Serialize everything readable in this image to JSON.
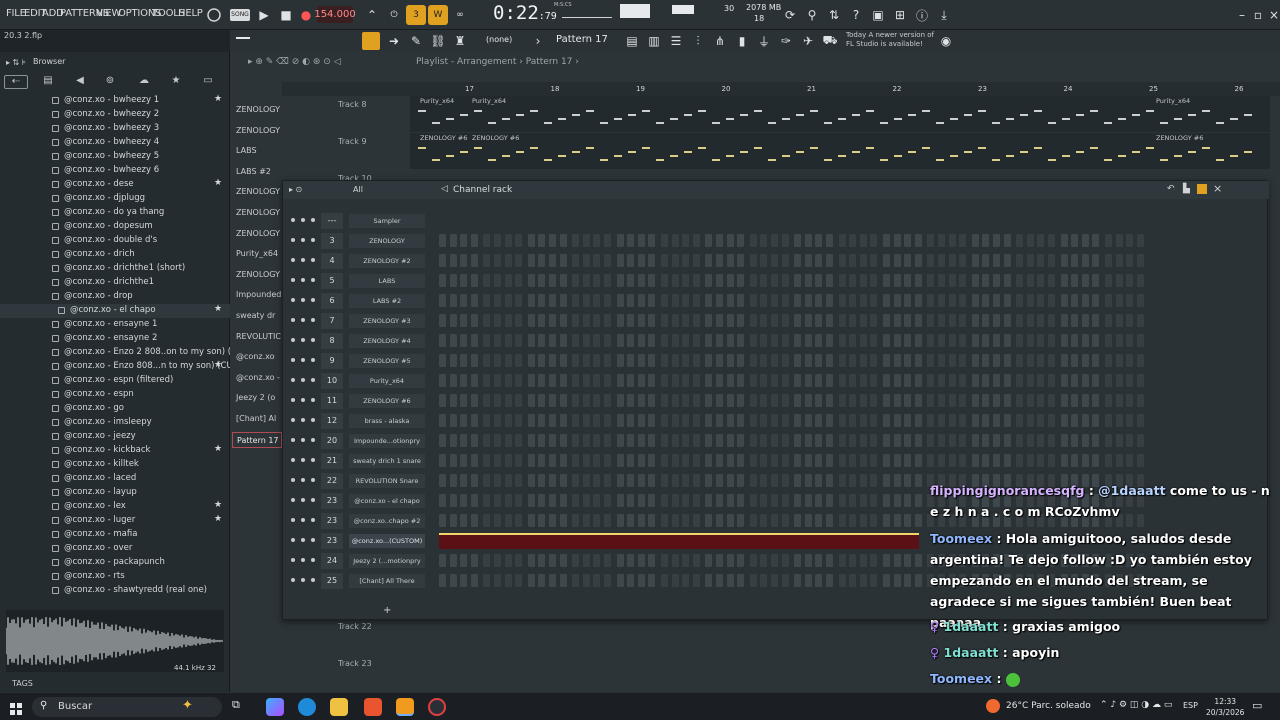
{
  "menu": [
    "FILE",
    "EDIT",
    "ADD",
    "PATTERNS",
    "VIEW",
    "OPTIONS",
    "TOOLS",
    "HELP"
  ],
  "transport": {
    "mode_badge": "SONG",
    "tempo": "154.000",
    "time_main": "0:22",
    "time_frac": ":79",
    "time_unit": "M:S:CS",
    "memory": "2078 MB",
    "cpu_top": "30",
    "cpu_bottom": "18"
  },
  "project": {
    "file": "20.3 2.flp"
  },
  "toolbar": {
    "none_label": "(none)",
    "pattern_label": "Pattern 17",
    "update_hint_line1": "Today  A newer version of",
    "update_hint_line2": "FL Studio is available!"
  },
  "browser": {
    "title": "Browser",
    "items": [
      {
        "label": "@conz.xo - bwheezy 1",
        "star": true
      },
      {
        "label": "@conz.xo - bwheezy 2",
        "star": false
      },
      {
        "label": "@conz.xo - bwheezy 3",
        "star": false
      },
      {
        "label": "@conz.xo - bwheezy 4",
        "star": false
      },
      {
        "label": "@conz.xo - bwheezy 5",
        "star": false
      },
      {
        "label": "@conz.xo - bwheezy 6",
        "star": false
      },
      {
        "label": "@conz.xo - dese",
        "star": true
      },
      {
        "label": "@conz.xo - djplugg",
        "star": false
      },
      {
        "label": "@conz.xo - do ya thang",
        "star": false
      },
      {
        "label": "@conz.xo - dopesum",
        "star": false
      },
      {
        "label": "@conz.xo - double d's",
        "star": false
      },
      {
        "label": "@conz.xo - drich",
        "star": false
      },
      {
        "label": "@conz.xo - drichthe1 (short)",
        "star": false
      },
      {
        "label": "@conz.xo - drichthe1",
        "star": false
      },
      {
        "label": "@conz.xo - drop",
        "star": false
      },
      {
        "label": "@conz.xo - el chapo",
        "star": true,
        "selected": true
      },
      {
        "label": "@conz.xo - ensayne 1",
        "star": false
      },
      {
        "label": "@conz.xo - ensayne 2",
        "star": false
      },
      {
        "label": "@conz.xo - Enzo 2 808..on to my son) (CUSTOM)",
        "star": false
      },
      {
        "label": "@conz.xo - Enzo 808...n to my son) (CUSTOM)",
        "star": true
      },
      {
        "label": "@conz.xo - espn (filtered)",
        "star": false
      },
      {
        "label": "@conz.xo - espn",
        "star": false
      },
      {
        "label": "@conz.xo - go",
        "star": false
      },
      {
        "label": "@conz.xo - imsleepy",
        "star": false
      },
      {
        "label": "@conz.xo - jeezy",
        "star": false
      },
      {
        "label": "@conz.xo - kickback",
        "star": true
      },
      {
        "label": "@conz.xo - killtek",
        "star": false
      },
      {
        "label": "@conz.xo - laced",
        "star": false
      },
      {
        "label": "@conz.xo - layup",
        "star": false
      },
      {
        "label": "@conz.xo - lex",
        "star": true
      },
      {
        "label": "@conz.xo - luger",
        "star": true
      },
      {
        "label": "@conz.xo - mafia",
        "star": false
      },
      {
        "label": "@conz.xo - over",
        "star": false
      },
      {
        "label": "@conz.xo - packapunch",
        "star": false
      },
      {
        "label": "@conz.xo - rts",
        "star": false
      },
      {
        "label": "@conz.xo - shawtyredd (real one)",
        "star": false
      }
    ],
    "sample_info": "44.1 kHz 32",
    "tags_label": "TAGS"
  },
  "playlist": {
    "title": "Playlist - Arrangement",
    "pattern": "Pattern 17",
    "ruler": [
      "17",
      "18",
      "19",
      "20",
      "21",
      "22",
      "23",
      "24",
      "25",
      "26"
    ],
    "patterns": [
      "ZENOLOGY",
      "ZENOLOGY #2",
      "LABS",
      "LABS #2",
      "ZENOLOGY",
      "ZENOLOGY",
      "ZENOLOGY",
      "Purity_x64",
      "ZENOLOGY",
      "Impounded",
      "sweaty dr",
      "REVOLUTIC",
      "@conz.xo",
      "@conz.xo -",
      "Jeezy 2 (o",
      "[Chant] Al",
      "Pattern 17"
    ],
    "tracks": [
      {
        "label": "Track 8",
        "clips": [
          "Purity_x64",
          "Purity_x64",
          "Purity_x64"
        ]
      },
      {
        "label": "Track 9",
        "clips": [
          "ZENOLOGY #6",
          "ZENOLOGY #6",
          "ZENOLOGY #6"
        ]
      },
      {
        "label": "Track 10"
      }
    ],
    "bottom_tracks": [
      "Track 22",
      "Track 23"
    ]
  },
  "channel_rack": {
    "title": "Channel rack",
    "filter": "All",
    "channels": [
      {
        "num": "---",
        "name": "Sampler"
      },
      {
        "num": "3",
        "name": "ZENOLOGY"
      },
      {
        "num": "4",
        "name": "ZENOLOGY #2"
      },
      {
        "num": "5",
        "name": "LABS"
      },
      {
        "num": "6",
        "name": "LABS #2"
      },
      {
        "num": "7",
        "name": "ZENOLOGY #3"
      },
      {
        "num": "8",
        "name": "ZENOLOGY #4"
      },
      {
        "num": "9",
        "name": "ZENOLOGY #5"
      },
      {
        "num": "10",
        "name": "Purity_x64"
      },
      {
        "num": "11",
        "name": "ZENOLOGY #6"
      },
      {
        "num": "12",
        "name": "brass - alaska"
      },
      {
        "num": "20",
        "name": "Impounde...otionpry"
      },
      {
        "num": "21",
        "name": "sweaty drich 1 snare"
      },
      {
        "num": "22",
        "name": "REVOLUTION Snare"
      },
      {
        "num": "23",
        "name": "@conz.xo - el chapo"
      },
      {
        "num": "23",
        "name": "@conz.xo..chapo #2"
      },
      {
        "num": "23",
        "name": "@conz.xo...(CUSTOM)",
        "highlight": true
      },
      {
        "num": "24",
        "name": "Jeezy 2 (...motionpry"
      },
      {
        "num": "25",
        "name": "[Chant] All There"
      }
    ]
  },
  "chat": [
    {
      "user": "flippingignorancesqfg",
      "mention": "@1daaatt",
      "text": " come to us - n e z h n a . c o m RCoZvhmv",
      "color": "purple"
    },
    {
      "user": "Toomeex",
      "text": " : Hola amiguitooo, saludos desde argentina! Te dejo follow :D yo también estoy empezando en el mundo del stream, se agradece si me sigues también! Buen beat paaaaa",
      "color": "blue"
    },
    {
      "user": "1daaatt",
      "text": " : graxias amigoo",
      "color": "teal"
    },
    {
      "user": "1daaatt",
      "text": " : apoyin",
      "color": "teal"
    },
    {
      "user": "Toomeex",
      "text": " : ",
      "color": "blue"
    }
  ],
  "taskbar": {
    "search_placeholder": "Buscar",
    "weather": "26°C  Parc. soleado",
    "lang": "ESP",
    "time": "12:33",
    "date": "20/3/2026"
  },
  "colors": {
    "accent": "#f0a020",
    "highlight_row": "#5a1014",
    "tempo": "#ff8a8a"
  }
}
